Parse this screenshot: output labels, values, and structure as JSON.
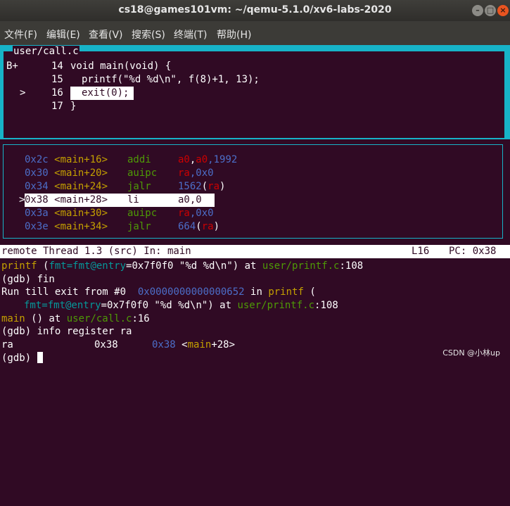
{
  "window": {
    "title": "cs18@games101vm: ~/qemu-5.1.0/xv6-labs-2020",
    "controls": {
      "minimize": "–",
      "maximize": "□",
      "close": "×"
    }
  },
  "menu": [
    "文件(F)",
    "编辑(E)",
    "查看(V)",
    "搜索(S)",
    "终端(T)",
    "帮助(H)"
  ],
  "source": {
    "filename": "user/call.c",
    "lines": [
      {
        "marker": "B+",
        "num": "14",
        "code": "void main(void) {"
      },
      {
        "marker": "",
        "num": "15",
        "code": "printf(\"%d %d\\n\", f(8)+1, 13);"
      },
      {
        "marker": ">",
        "num": "16",
        "code": "exit(0);"
      },
      {
        "marker": "",
        "num": "17",
        "code": "}"
      }
    ]
  },
  "asm": [
    {
      "addr": "0x2c",
      "sym": "<main+16>",
      "op": "addi",
      "args": [
        "a0",
        ",",
        "a0",
        ",1992"
      ]
    },
    {
      "addr": "0x30",
      "sym": "<main+20>",
      "op": "auipc",
      "args": [
        "ra",
        ",0x0"
      ]
    },
    {
      "addr": "0x34",
      "sym": "<main+24>",
      "op": "jalr",
      "args": [
        "1562",
        "(",
        "ra",
        ")"
      ]
    },
    {
      "addr": "0x38",
      "sym": "<main+28>",
      "op": "li",
      "args": [
        "a0,0"
      ]
    },
    {
      "addr": "0x3a",
      "sym": "<main+30>",
      "op": "auipc",
      "args": [
        "ra",
        ",0x0"
      ]
    },
    {
      "addr": "0x3e",
      "sym": "<main+34>",
      "op": "jalr",
      "args": [
        "664",
        "(",
        "ra",
        ")"
      ]
    }
  ],
  "status": {
    "left": "remote Thread 1.3 (src) In: main",
    "line": "L16",
    "pc": "PC: 0x38"
  },
  "console": {
    "l1_fn": "printf",
    "l1_args_a": "(",
    "l1_arg": "fmt=fmt@entry",
    "l1_args_b": "=0x7f0f0 \"%d %d\\n\") at ",
    "l1_path": "user/printf.c",
    "l1_tail": ":108",
    "l2": "(gdb) fin",
    "l3_a": "Run till exit from #0  ",
    "l3_addr": "0x0000000000000652",
    "l3_b": " in ",
    "l3_fn": "printf",
    "l3_c": " (",
    "l4_arg": "fmt=fmt@entry",
    "l4_b": "=0x7f0f0 \"%d %d\\n\") at ",
    "l4_path": "user/printf.c",
    "l4_tail": ":108",
    "l5_fn": "main",
    "l5_b": " () at ",
    "l5_path": "user/call.c",
    "l5_tail": ":16",
    "l6": "(gdb) info register ra",
    "l7_reg": "ra",
    "l7_val": "0x38",
    "l7_addr": "0x38",
    "l7_sym_a": "<",
    "l7_sym_fn": "main",
    "l7_sym_b": "+28>",
    "l8": "(gdb) "
  },
  "watermark": "CSDN @小林up"
}
